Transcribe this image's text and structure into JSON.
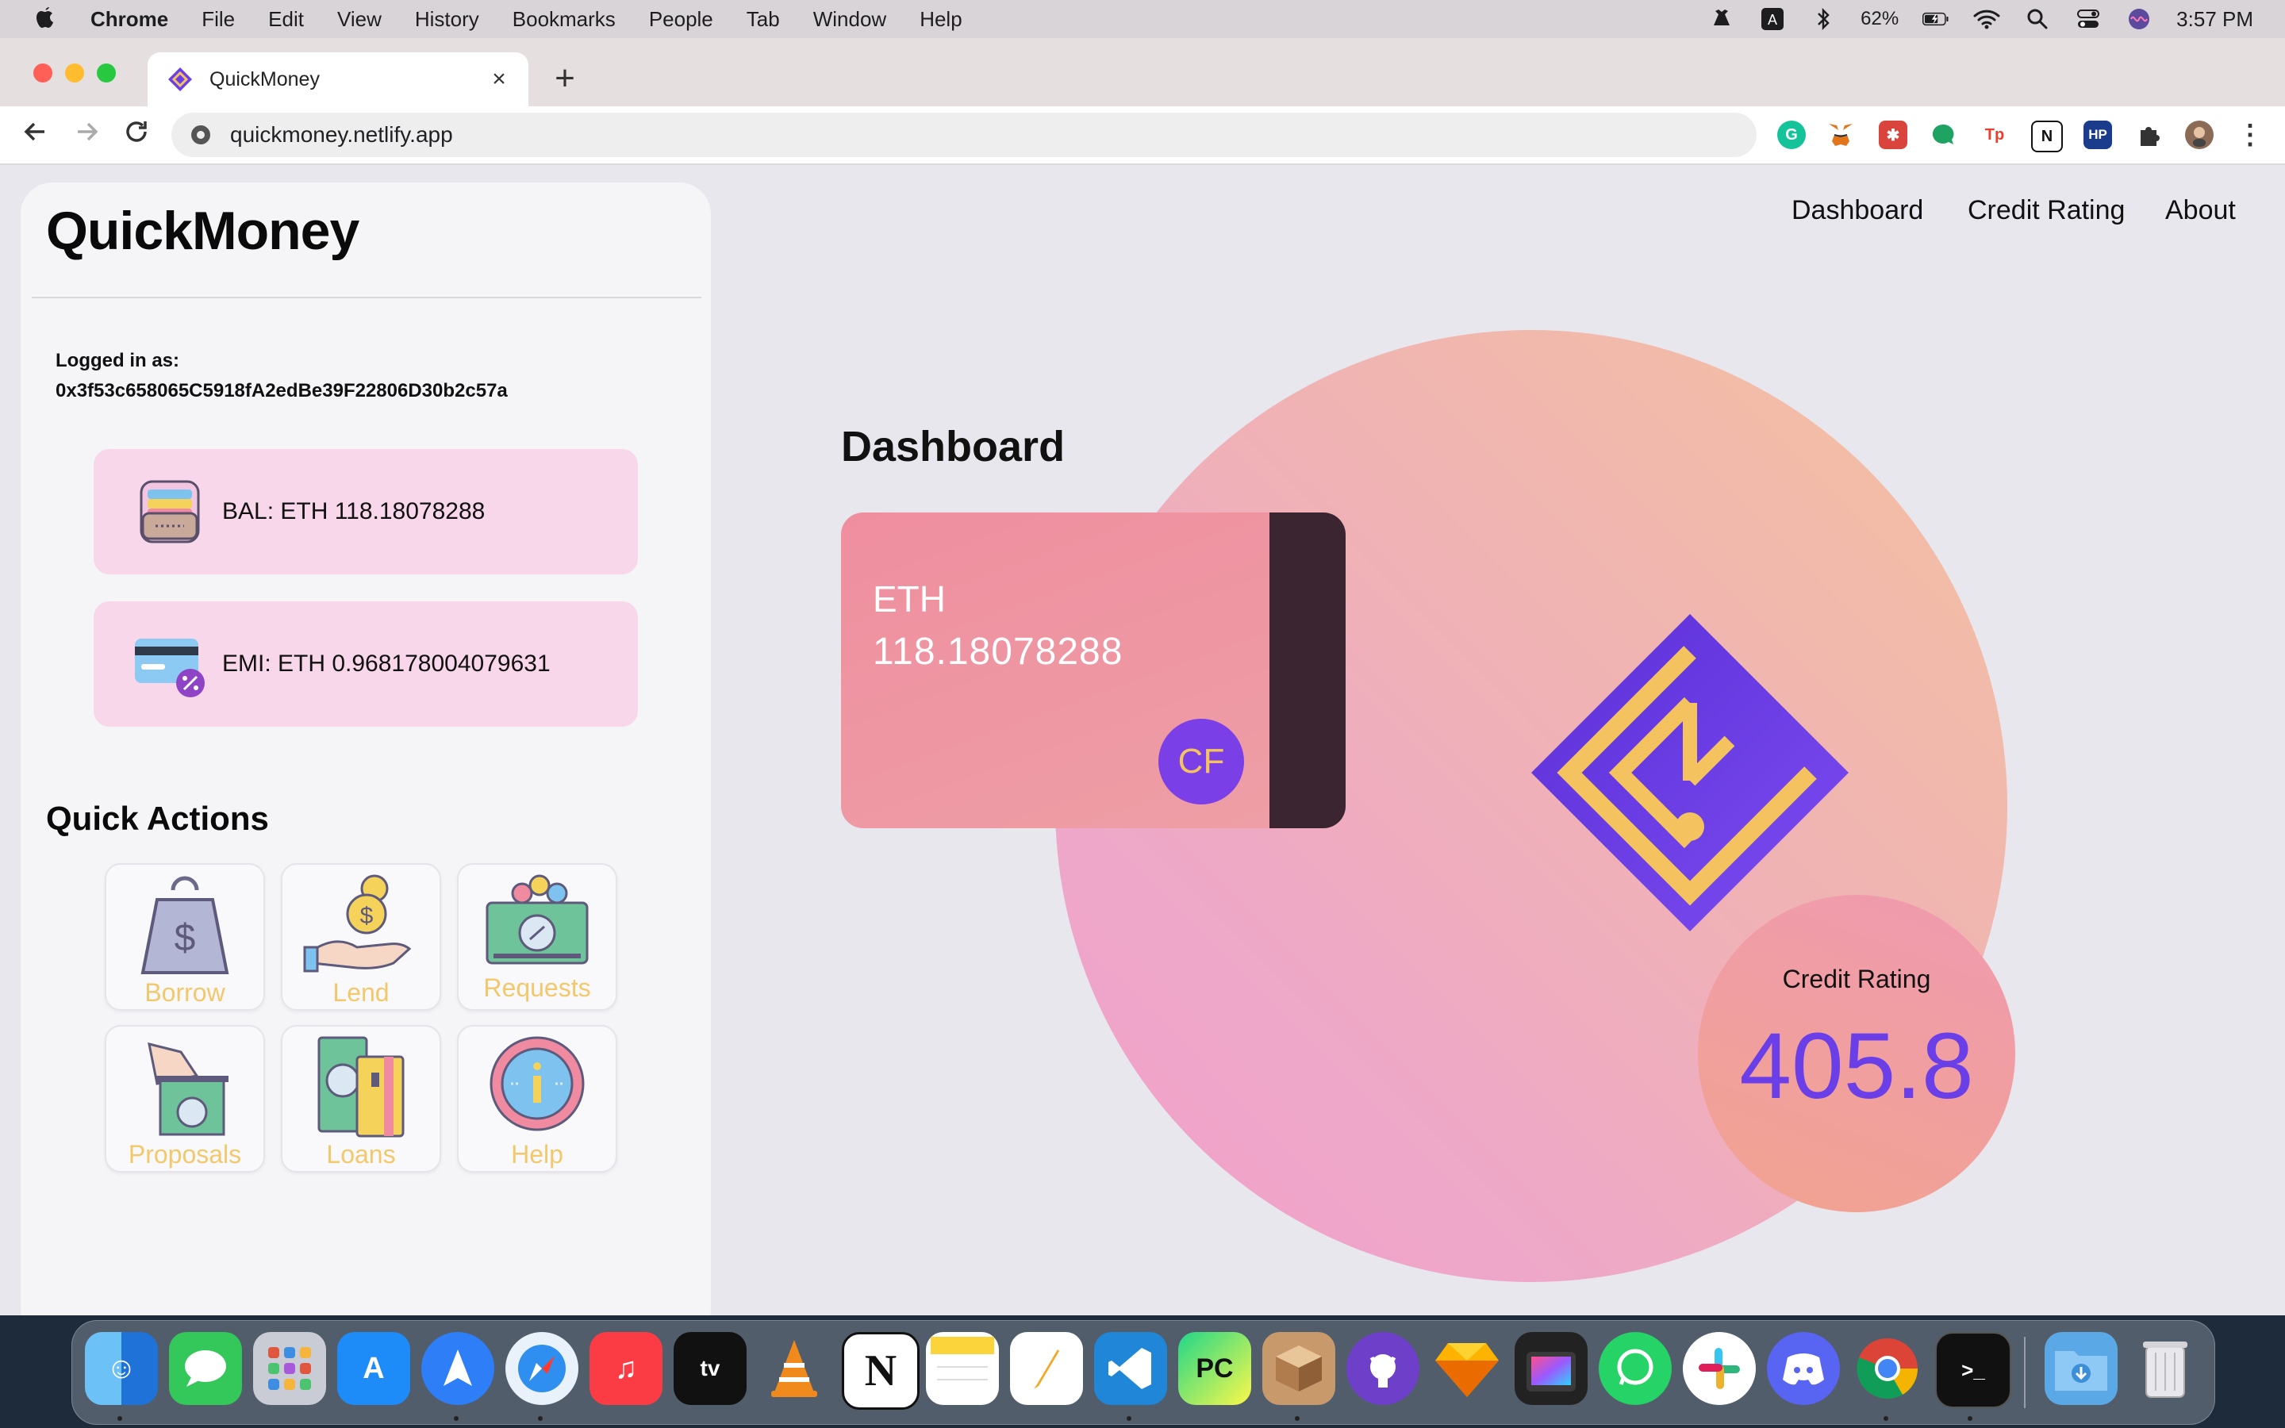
{
  "menubar": {
    "app": "Chrome",
    "items": [
      "File",
      "Edit",
      "View",
      "History",
      "Bookmarks",
      "People",
      "Tab",
      "Window",
      "Help"
    ],
    "battery": "62%",
    "clock": "3:57 PM"
  },
  "browser": {
    "tab_title": "QuickMoney",
    "url": "quickmoney.netlify.app"
  },
  "sidebar": {
    "brand": "QuickMoney",
    "logged_label": "Logged in as:",
    "address": "0x3f53c658065C5918fA2edBe39F22806D30b2c57a",
    "balance": "BAL: ETH 118.18078288",
    "emi": "EMI: ETH 0.968178004079631",
    "quick_actions_title": "Quick Actions",
    "actions": [
      "Borrow",
      "Lend",
      "Requests",
      "Proposals",
      "Loans",
      "Help"
    ]
  },
  "nav": {
    "dashboard": "Dashboard",
    "credit_rating": "Credit Rating",
    "about": "About"
  },
  "main": {
    "title": "Dashboard",
    "card": {
      "currency": "ETH",
      "amount": "118.18078288",
      "badge": "CF"
    },
    "credit": {
      "label": "Credit Rating",
      "value": "405.8"
    }
  },
  "colors": {
    "accent_purple": "#6b3fe8",
    "accent_gold": "#f4c35f",
    "card_pink": "#ef8e9f",
    "info_card_bg": "#f8d7ea"
  }
}
